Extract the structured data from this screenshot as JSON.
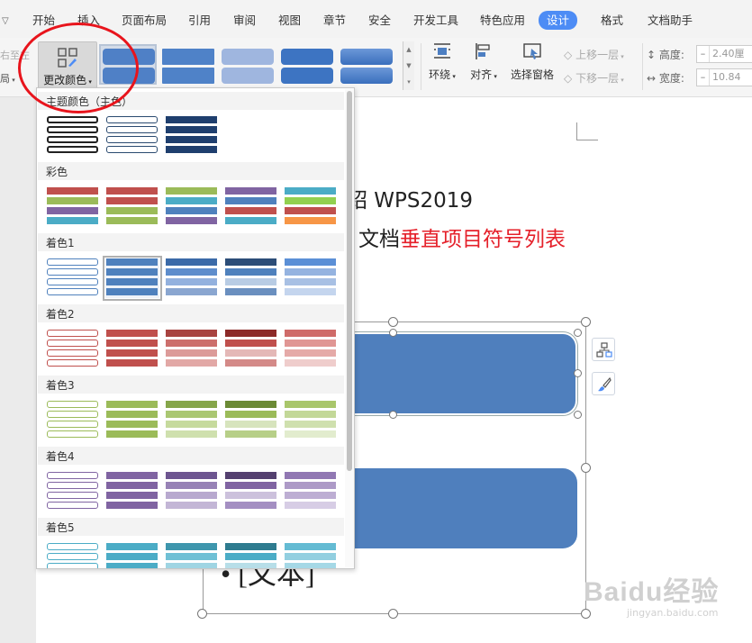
{
  "menu": {
    "tabs": [
      {
        "label": "开始"
      },
      {
        "label": "插入"
      },
      {
        "label": "页面布局"
      },
      {
        "label": "引用"
      },
      {
        "label": "审阅"
      },
      {
        "label": "视图"
      },
      {
        "label": "章节"
      },
      {
        "label": "安全"
      },
      {
        "label": "开发工具"
      },
      {
        "label": "特色应用"
      },
      {
        "label": "设计"
      },
      {
        "label": "格式"
      },
      {
        "label": "文档助手"
      }
    ],
    "active_tab": "设计"
  },
  "ribbon": {
    "left_clipped_top": "右至左",
    "left_clipped_bottom": "局",
    "change_color_label": "更改颜色",
    "wrap_label": "环绕",
    "align_label": "对齐",
    "selection_pane_label": "选择窗格",
    "bring_forward_label": "上移一层",
    "send_backward_label": "下移一层",
    "height_label": "高度:",
    "height_value": "2.40厘",
    "width_label": "宽度:",
    "width_value": "10.84"
  },
  "dropdown": {
    "sections": [
      {
        "label": "主题颜色（主色）"
      },
      {
        "label": "彩色"
      },
      {
        "label": "着色1"
      },
      {
        "label": "着色2"
      },
      {
        "label": "着色3"
      },
      {
        "label": "着色4"
      },
      {
        "label": "着色5"
      }
    ]
  },
  "document": {
    "heading_line1": "介绍 WPS2019",
    "heading_line2_prefix": "文档",
    "heading_line2_highlight": "垂直项目符号列表",
    "bullet_text": "• [文本]"
  },
  "watermark": {
    "brand": "Baidu经验",
    "url": "jingyan.baidu.com"
  },
  "colors": {
    "accent_tab": "#4d8cf5",
    "shape_fill": "#4f7fbd",
    "highlight_red": "#e5202a",
    "annotation_circle": "#e8141c"
  }
}
